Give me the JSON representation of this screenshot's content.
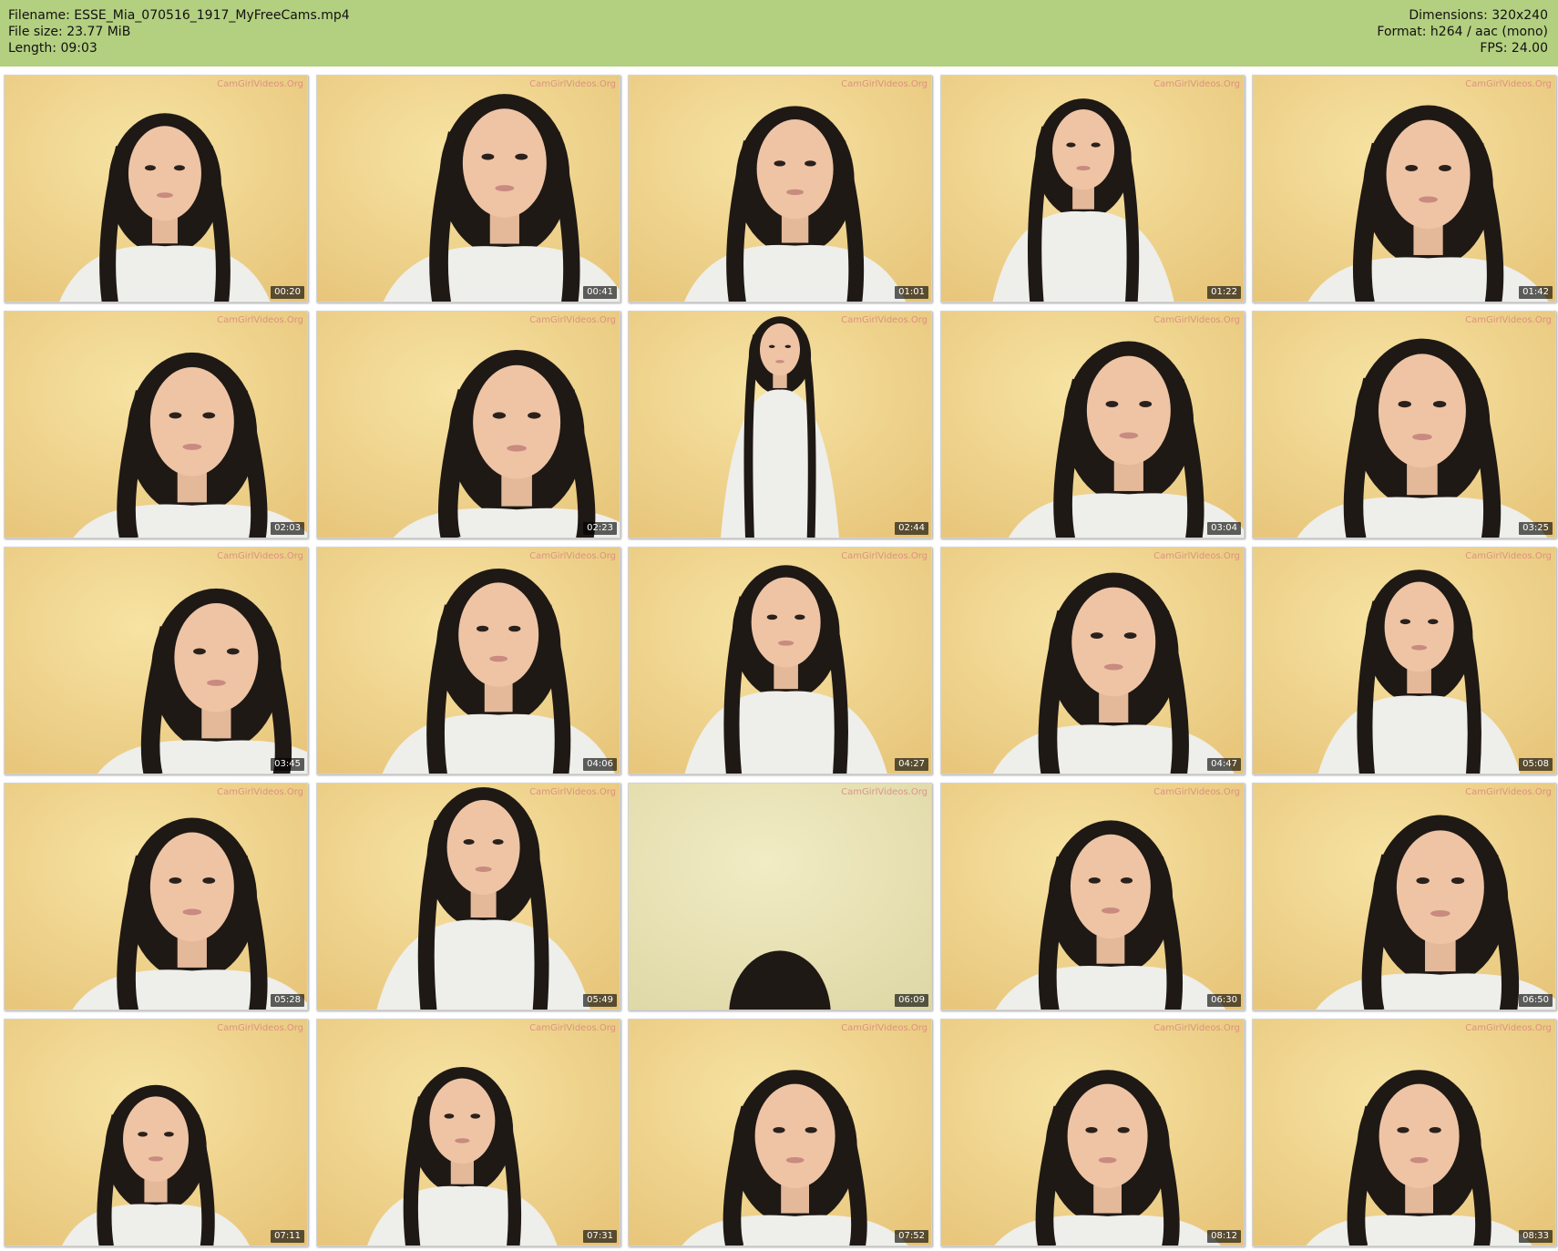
{
  "header": {
    "filename_label": "Filename: ESSE_Mia_070516_1917_MyFreeCams.mp4",
    "filesize_label": "File size: 23.77 MiB",
    "length_label": "Length: 09:03",
    "dimensions_label": "Dimensions: 320x240",
    "format_label": "Format: h264 / aac (mono)",
    "fps_label": "FPS: 24.00"
  },
  "colors": {
    "header_bg": "#b3cf80",
    "timestamp_bg": "#000000",
    "watermark": "#d77d7d"
  },
  "watermark_text": "CamGirlVideos.Org",
  "thumbnails": [
    {
      "time": "00:20"
    },
    {
      "time": "00:41"
    },
    {
      "time": "01:01"
    },
    {
      "time": "01:22"
    },
    {
      "time": "01:42"
    },
    {
      "time": "02:03"
    },
    {
      "time": "02:23"
    },
    {
      "time": "02:44"
    },
    {
      "time": "03:04"
    },
    {
      "time": "03:25"
    },
    {
      "time": "03:45"
    },
    {
      "time": "04:06"
    },
    {
      "time": "04:27"
    },
    {
      "time": "04:47"
    },
    {
      "time": "05:08"
    },
    {
      "time": "05:28"
    },
    {
      "time": "05:49"
    },
    {
      "time": "06:09"
    },
    {
      "time": "06:30"
    },
    {
      "time": "06:50"
    },
    {
      "time": "07:11"
    },
    {
      "time": "07:31"
    },
    {
      "time": "07:52"
    },
    {
      "time": "08:12"
    },
    {
      "time": "08:33"
    }
  ]
}
